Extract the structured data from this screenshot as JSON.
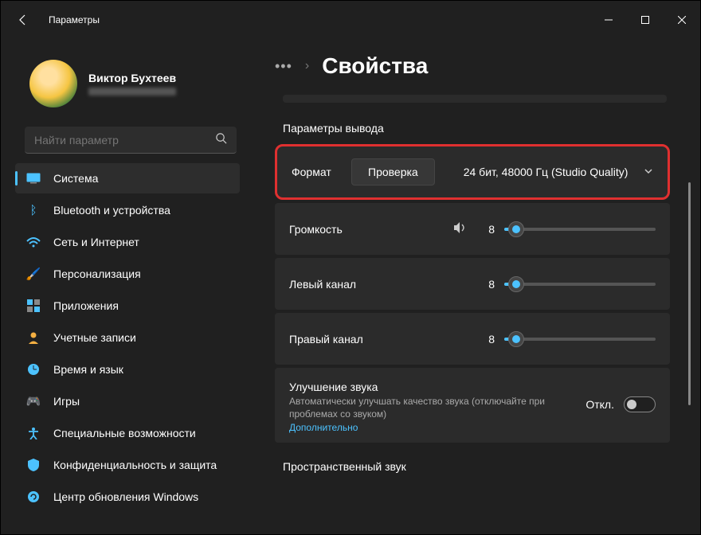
{
  "window": {
    "title": "Параметры"
  },
  "profile": {
    "name": "Виктор Бухтеев"
  },
  "search": {
    "placeholder": "Найти параметр"
  },
  "nav": {
    "items": [
      {
        "label": "Система",
        "selected": true
      },
      {
        "label": "Bluetooth и устройства"
      },
      {
        "label": "Сеть и Интернет"
      },
      {
        "label": "Персонализация"
      },
      {
        "label": "Приложения"
      },
      {
        "label": "Учетные записи"
      },
      {
        "label": "Время и язык"
      },
      {
        "label": "Игры"
      },
      {
        "label": "Специальные возможности"
      },
      {
        "label": "Конфиденциальность и защита"
      },
      {
        "label": "Центр обновления Windows"
      }
    ]
  },
  "breadcrumb": {
    "more": "•••",
    "sep": "›",
    "title": "Свойства"
  },
  "section": {
    "output_params": "Параметры вывода",
    "spatial": "Пространственный звук"
  },
  "format": {
    "label": "Формат",
    "test": "Проверка",
    "value": "24 бит, 48000 Гц (Studio Quality)"
  },
  "sliders": {
    "volume": {
      "label": "Громкость",
      "value": "8"
    },
    "left": {
      "label": "Левый канал",
      "value": "8"
    },
    "right": {
      "label": "Правый канал",
      "value": "8"
    }
  },
  "enhance": {
    "title": "Улучшение звука",
    "sub": "Автоматически улучшать качество звука (отключайте при проблемах со звуком)",
    "link": "Дополнительно",
    "state": "Откл."
  }
}
